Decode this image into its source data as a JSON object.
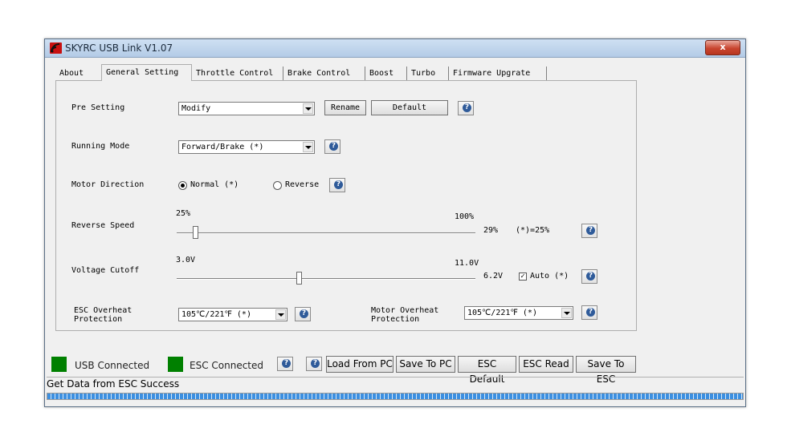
{
  "window": {
    "title": "SKYRC USB Link V1.07",
    "close_label": "x"
  },
  "tabs": [
    {
      "label": "About"
    },
    {
      "label": "General Setting",
      "active": true
    },
    {
      "label": "Throttle Control"
    },
    {
      "label": "Brake Control"
    },
    {
      "label": "Boost"
    },
    {
      "label": "Turbo"
    },
    {
      "label": "Firmware Upgrate"
    }
  ],
  "settings": {
    "pre_setting": {
      "label": "Pre Setting",
      "value": "Modify",
      "rename": "Rename",
      "default": "Default"
    },
    "running_mode": {
      "label": "Running Mode",
      "value": "Forward/Brake (*)"
    },
    "motor_direction": {
      "label": "Motor Direction",
      "normal": "Normal (*)",
      "reverse": "Reverse",
      "selected": "normal"
    },
    "reverse_speed": {
      "label": "Reverse Speed",
      "min": "25%",
      "max": "100%",
      "value": "29%",
      "default": "(*)=25%",
      "fraction": 0.053
    },
    "voltage_cutoff": {
      "label": "Voltage Cutoff",
      "min": "3.0V",
      "max": "11.0V",
      "value": "6.2V",
      "auto": "Auto (*)",
      "auto_checked": true,
      "fraction": 0.4
    },
    "esc_overheat": {
      "label_line1": "ESC Overheat",
      "label_line2": "Protection",
      "value": "105℃/221℉ (*)"
    },
    "motor_overheat": {
      "label_line1": "Motor Overheat",
      "label_line2": "Protection",
      "value": "105℃/221℉ (*)"
    }
  },
  "status": {
    "usb": "USB Connected",
    "esc": "ESC Connected",
    "color": "#008000"
  },
  "buttons": {
    "load_from_pc": "Load From PC",
    "save_to_pc": "Save To PC",
    "esc_default": "ESC Default",
    "esc_read": "ESC Read",
    "save_to_esc": "Save To ESC"
  },
  "statusbar": {
    "message": "Get Data from ESC Success",
    "progress": 1.0
  }
}
